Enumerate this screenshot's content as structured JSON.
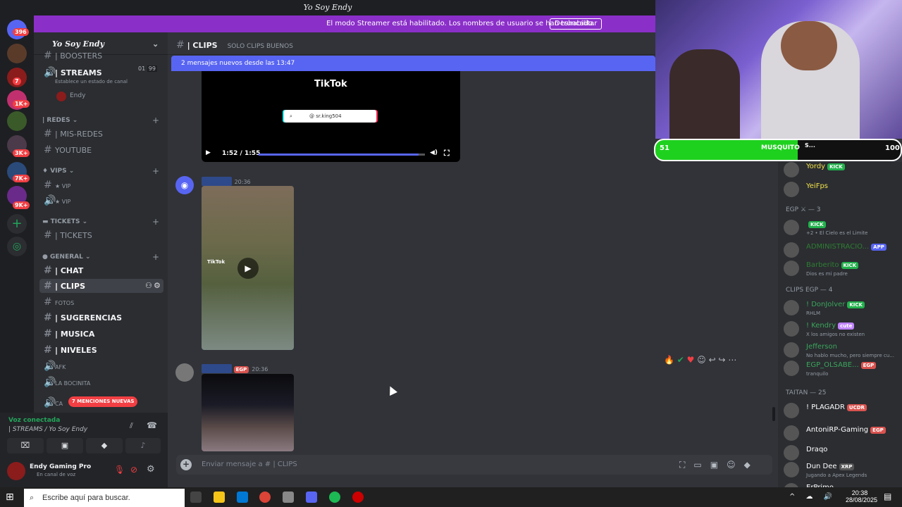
{
  "window": {
    "title": "Yo Soy Endy"
  },
  "banner": {
    "text": "El modo Streamer está habilitado. Los nombres de usuario se han truncado.",
    "button": "Deshabilitar"
  },
  "servers": {
    "badges": [
      "396",
      "7",
      "1K+",
      "3K+",
      "7K+",
      "9K+"
    ]
  },
  "server": {
    "name": "Yo Soy Endy"
  },
  "channels": {
    "boosters": "| BOOSTERS",
    "streams": "| STREAMS",
    "streams_status": "Establece un estado de canal",
    "streams_counts": [
      "01",
      "99"
    ],
    "voice_user": "Endy",
    "cat_redes": "| REDES",
    "mis_redes": "| MIS-REDES",
    "youtube": "YOUTUBE",
    "cat_vips": "VIPS",
    "vip1": "VIP",
    "vip2": "VIP",
    "cat_tickets": "TICKETS",
    "tickets": "| TICKETS",
    "cat_general": "GENERAL",
    "chat": "| CHAT",
    "clips": "| CLIPS",
    "fotos": "FOTOS",
    "sugerencias": "| SUGERENCIAS",
    "musica": "| MUSICA",
    "niveles": "| NIVELES",
    "afk": "AFK",
    "bocinita": "LA BOCINITA",
    "cat_last": "CA",
    "mentions": "7 MENCIONES NUEVAS"
  },
  "voice": {
    "status": "Voz conectada",
    "channel": "| STREAMS / Yo Soy Endy"
  },
  "user": {
    "name": "Endy Gaming Pro",
    "status": "En canal de voz"
  },
  "header": {
    "channel": "| CLIPS",
    "topic": "SOLO CLIPS BUENOS"
  },
  "newmessages": "2 mensajes nuevos desde las 13:47",
  "tiktok": {
    "logo": "TikTok",
    "handle": "sr.king504",
    "time": "1:52 / 1:55",
    "progress": 0.96
  },
  "messages": [
    {
      "time": "20:36",
      "video_label": "TikTok"
    },
    {
      "time": "20:36",
      "tag": "EGP"
    }
  ],
  "composer": {
    "placeholder": "Enviar mensaje a #",
    "channel": "| CLIPS"
  },
  "streamer": {
    "left": "51",
    "name": "MUSQUITO",
    "s": "S...",
    "right": "100",
    "fill": 0.58
  },
  "members": [
    {
      "name": "Yordy",
      "tag": "KICK",
      "color": "#f0e04a",
      "tagcolor": "#22b14c"
    },
    {
      "name": "YeiFps",
      "color": "#f0e04a"
    },
    {
      "category": "EGP ⚔ — 3"
    },
    {
      "name": "",
      "tag": "KICK",
      "status": "+2 • El Cielo es el Limite",
      "color": "#c9cdfb",
      "tagcolor": "#22b14c"
    },
    {
      "name": "ADMINISTRACIO...",
      "tag": "APP",
      "color": "#2e7d32",
      "tagcolor": "#5865f2"
    },
    {
      "name": "Barberito",
      "tag": "KICK",
      "status": "Dios es mi padre",
      "color": "#2e7d32",
      "tagcolor": "#22b14c"
    },
    {
      "category": "CLIPS EGP — 4"
    },
    {
      "name": "! DonJolver",
      "tag": "KICK",
      "status": "RHLM",
      "color": "#3ba55c",
      "tagcolor": "#22b14c"
    },
    {
      "name": "! Kendry",
      "tag": "cute",
      "status": "X los amigos no existen",
      "color": "#3ba55c",
      "tagcolor": "#c084fc"
    },
    {
      "name": "Jefferson",
      "status": "No hablo mucho, pero siempre cu...",
      "color": "#3ba55c"
    },
    {
      "name": "EGP_OLSABE...",
      "tag": "EGP",
      "status": "tranquilo",
      "color": "#3ba55c",
      "tagcolor": "#d9534f"
    },
    {
      "category": "TAITAN — 25"
    },
    {
      "name": "! PLAGADR",
      "tag": "UCDR",
      "color": "#fff",
      "tagcolor": "#d9534f"
    },
    {
      "name": "AntoniRP-Gaming",
      "tag": "EGP",
      "color": "#fff",
      "tagcolor": "#d9534f"
    },
    {
      "name": "Draqo",
      "color": "#fff"
    },
    {
      "name": "Dun Dee",
      "tag": "XRP",
      "status": "Jugando a Apex Legends",
      "color": "#fff",
      "tagcolor": "#555"
    },
    {
      "name": "ErPrimo",
      "color": "#fff"
    }
  ],
  "taskbar": {
    "search": "Escribe aquí para buscar.",
    "time": "20:38",
    "date": "28/08/2025"
  }
}
